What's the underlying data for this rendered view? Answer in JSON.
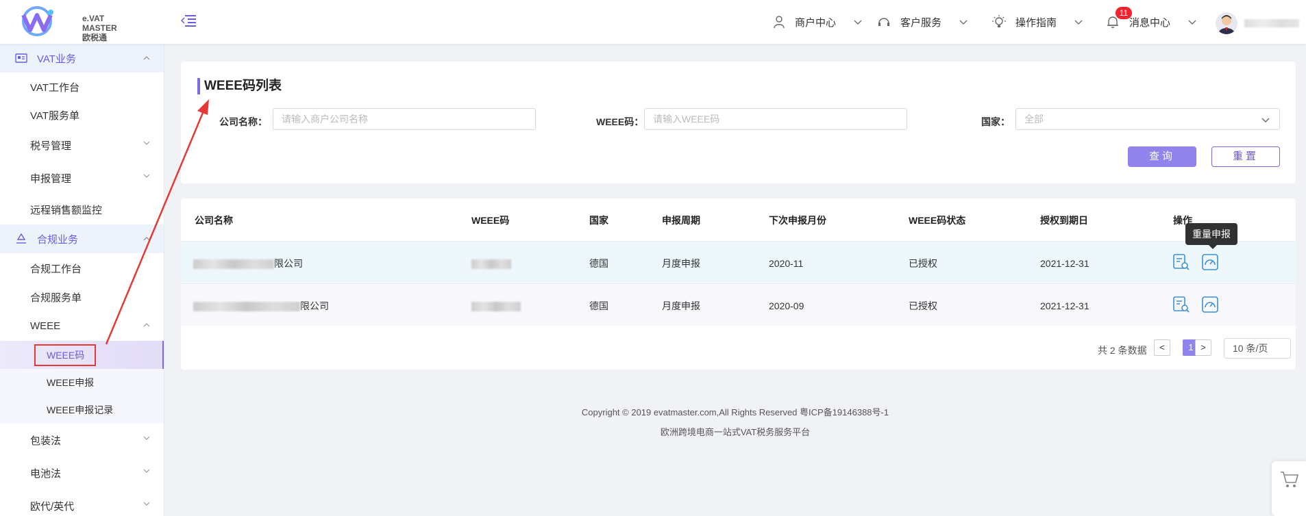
{
  "brand": {
    "line1": "e.VAT",
    "line2": "MASTER",
    "line3": "欧税通"
  },
  "header": {
    "merchant_center": "商户中心",
    "customer_service": "客户服务",
    "guide": "操作指南",
    "messages": "消息中心",
    "message_count": "11"
  },
  "sidebar": {
    "vat_group": "VAT业务",
    "vat_items": [
      "VAT工作台",
      "VAT服务单",
      "税号管理",
      "申报管理",
      "远程销售额监控"
    ],
    "compliance_group": "合规业务",
    "compliance_items": [
      "合规工作台",
      "合规服务单",
      "WEEE"
    ],
    "weee_items": [
      "WEEE码",
      "WEEE申报",
      "WEEE申报记录"
    ],
    "more_items": [
      "包装法",
      "电池法",
      "欧代/英代"
    ]
  },
  "search": {
    "title": "WEEE码列表",
    "company_label": "公司名称：",
    "company_placeholder": "请输入商户公司名称",
    "weee_label": "WEEE码：",
    "weee_placeholder": "请输入WEEE码",
    "country_label": "国家：",
    "country_value": "全部",
    "query_button": "查询",
    "reset_button": "重置"
  },
  "table": {
    "columns": [
      "公司名称",
      "WEEE码",
      "国家",
      "申报周期",
      "下次申报月份",
      "WEEE码状态",
      "授权到期日",
      "操作"
    ],
    "rows": [
      {
        "company_suffix": "限公司",
        "country": "德国",
        "cycle": "月度申报",
        "next_month": "2020-11",
        "status": "已授权",
        "expiry": "2021-12-31"
      },
      {
        "company_suffix": "限公司",
        "country": "德国",
        "cycle": "月度申报",
        "next_month": "2020-09",
        "status": "已授权",
        "expiry": "2021-12-31"
      }
    ],
    "tooltip": "重量申报"
  },
  "pagination": {
    "total": "共 2 条数据",
    "prev": "<",
    "current": "1",
    "next": ">",
    "page_size": "10 条/页"
  },
  "footer": {
    "copyright": "Copyright © 2019 evatmaster.com,All Rights Reserved 粤ICP备19146388号-1",
    "slogan": "欧洲跨境电商一站式VAT税务服务平台"
  },
  "colors": {
    "accent": "#7b6be8",
    "primary_button": "#9183ec",
    "badge": "#f5222d",
    "highlight_row": "#eef7fb"
  }
}
